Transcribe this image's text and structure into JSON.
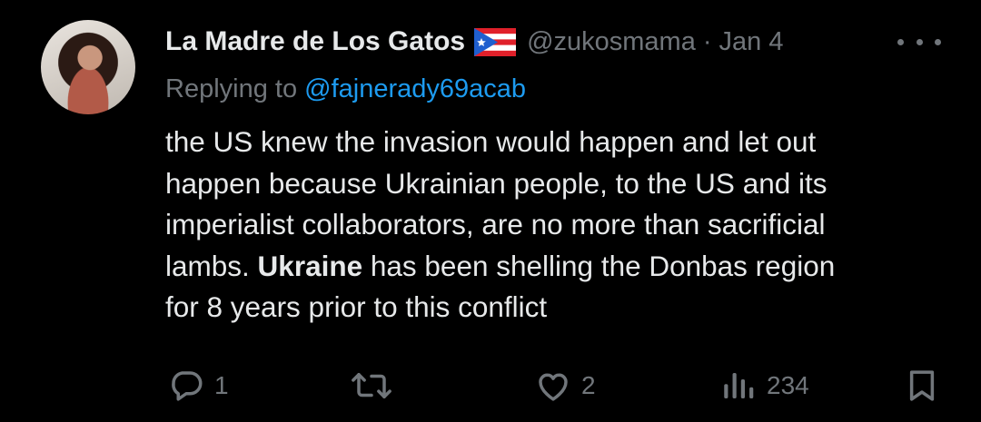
{
  "author": {
    "name": "La Madre de Los Gatos",
    "flag_icon": "puerto-rico-flag-icon",
    "handle": "@zukosmama",
    "separator": "·",
    "date": "Jan 4"
  },
  "reply": {
    "prefix": "Replying to",
    "mention": "@fajnerady69acab"
  },
  "body": {
    "line1": "the US knew the invasion would happen and let out",
    "line2": "happen because Ukrainian people, to the US and its",
    "line3": "imperialist collaborators, are no more than sacrificial",
    "line4_bold": "Ukraine",
    "line4_pre": "lambs.",
    "line4_post": "has been shelling the Donbas region",
    "line5": "for 8 years prior to this conflict"
  },
  "actions": {
    "reply_count": "1",
    "retweet_count": "",
    "like_count": "2",
    "views_count": "234"
  },
  "colors": {
    "background": "#000000",
    "text": "#e7e9ea",
    "muted": "#71767b",
    "link": "#1d9bf0"
  }
}
